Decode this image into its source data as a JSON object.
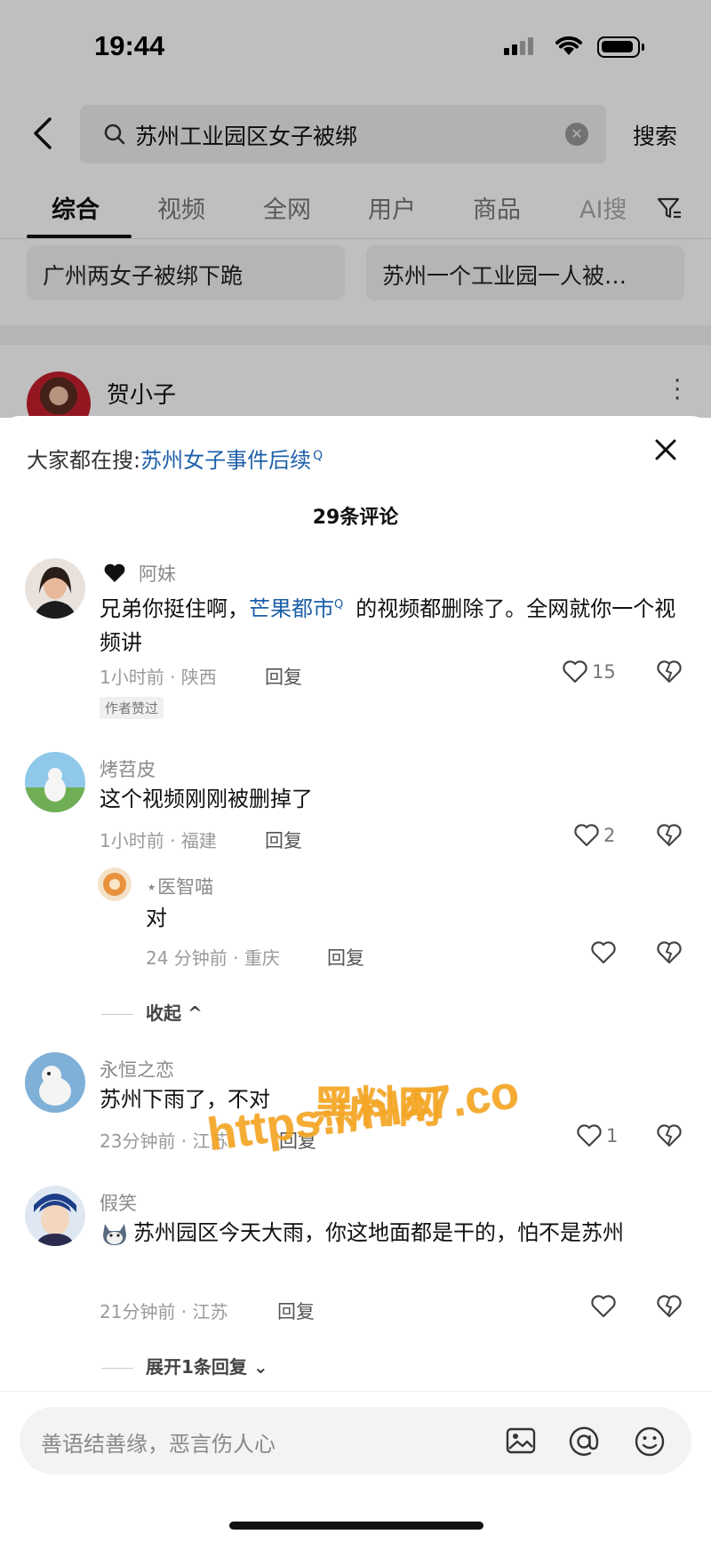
{
  "status_bar": {
    "time": "19:44"
  },
  "search": {
    "query": "苏州工业园区女子被绑",
    "submit_label": "搜索",
    "icons": [
      "back-arrow-icon",
      "search-icon",
      "clear-icon"
    ]
  },
  "tabs": [
    {
      "label": "综合",
      "active": true
    },
    {
      "label": "视频"
    },
    {
      "label": "全网"
    },
    {
      "label": "用户"
    },
    {
      "label": "商品"
    },
    {
      "label": "AI搜"
    }
  ],
  "suggestions": [
    "广州两女子被绑下跪",
    "苏州一个工业园一人被…"
  ],
  "background_post": {
    "username": "贺小子"
  },
  "comment_sheet": {
    "trending_prefix": "大家都在搜:",
    "trending_topic": "苏州女子事件后续",
    "comment_count": "29条评论",
    "comments": [
      {
        "username": "阿妹",
        "text_before": "兄弟你挺住啊，",
        "link": "芒果都市",
        "text_after": "的视频都删除了。全网就你一个视频讲",
        "meta": "1小时前 · 陕西",
        "reply_label": "回复",
        "likes": "15",
        "badge": "作者赞过"
      },
      {
        "username": "烤苕皮",
        "text": "这个视频刚刚被删掉了",
        "meta": "1小时前 · 福建",
        "reply_label": "回复",
        "likes": "2",
        "replies": [
          {
            "username": "⋆医智喵",
            "text": "对",
            "meta": "24 分钟前 · 重庆",
            "reply_label": "回复"
          }
        ],
        "collapse_label": "收起"
      },
      {
        "username": "永恒之恋",
        "text": "苏州下雨了，不对",
        "meta": "23分钟前 · 江苏",
        "reply_label": "回复",
        "likes": "1"
      },
      {
        "username": "假笑",
        "text": "苏州园区今天大雨，你这地面都是干的，怕不是苏州",
        "meta": "21分钟前 · 江苏",
        "reply_label": "回复",
        "expand_label": "展开1条回复"
      }
    ]
  },
  "watermark": {
    "line1": "黑料网",
    "line2": "https://hl47.co"
  },
  "input_bar": {
    "placeholder": "善语结善缘，恶言伤人心",
    "icons": [
      "image-icon",
      "mention-icon",
      "emoji-icon"
    ]
  },
  "colors": {
    "link": "#1d5fa8",
    "watermark": "#f5a623"
  }
}
